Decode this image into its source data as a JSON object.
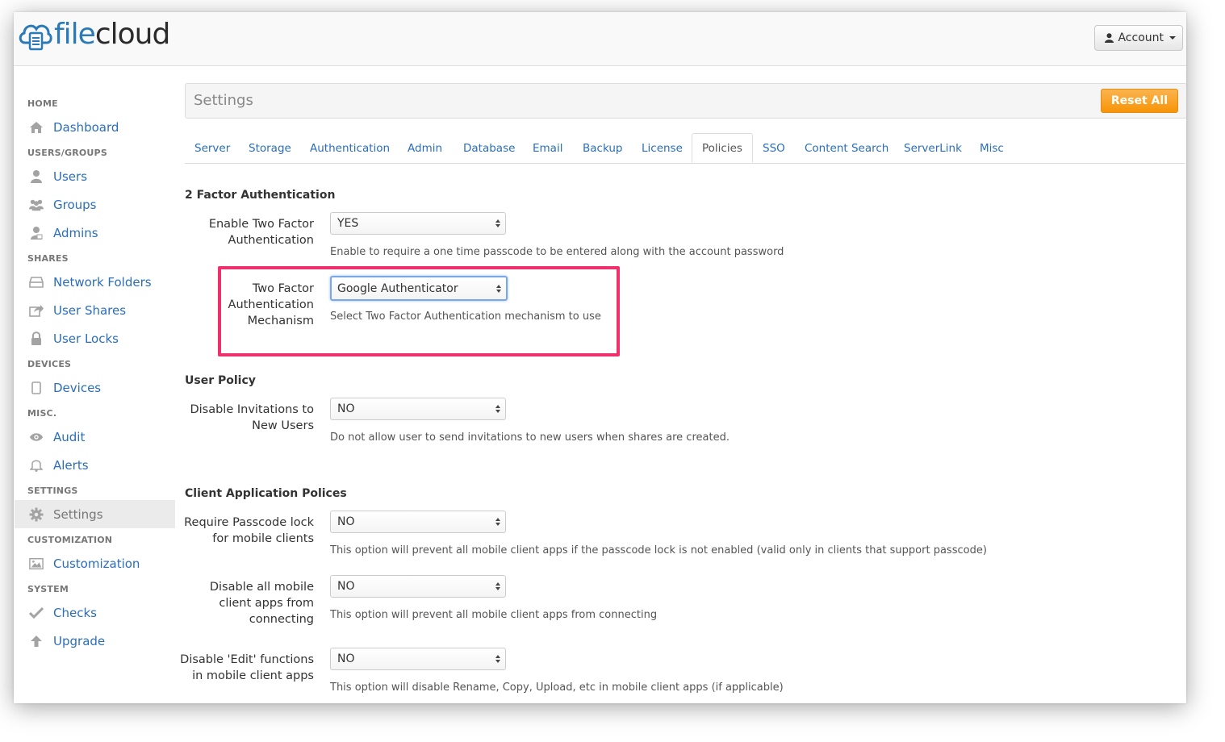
{
  "app": {
    "logo_file": "file",
    "logo_cloud": "cloud",
    "account_label": "Account"
  },
  "sidebar": {
    "sections": [
      {
        "label": "HOME"
      },
      {
        "label": "USERS/GROUPS"
      },
      {
        "label": "SHARES"
      },
      {
        "label": "DEVICES"
      },
      {
        "label": "MISC."
      },
      {
        "label": "SETTINGS"
      },
      {
        "label": "CUSTOMIZATION"
      },
      {
        "label": "SYSTEM"
      }
    ],
    "items": [
      {
        "label": "Dashboard",
        "icon": "home-icon"
      },
      {
        "label": "Users",
        "icon": "user-icon"
      },
      {
        "label": "Groups",
        "icon": "group-icon"
      },
      {
        "label": "Admins",
        "icon": "admin-icon"
      },
      {
        "label": "Network Folders",
        "icon": "drive-icon"
      },
      {
        "label": "User Shares",
        "icon": "share-icon"
      },
      {
        "label": "User Locks",
        "icon": "lock-icon"
      },
      {
        "label": "Devices",
        "icon": "device-icon"
      },
      {
        "label": "Audit",
        "icon": "eye-icon"
      },
      {
        "label": "Alerts",
        "icon": "bell-icon"
      },
      {
        "label": "Settings",
        "icon": "gear-icon",
        "active": true
      },
      {
        "label": "Customization",
        "icon": "picture-icon"
      },
      {
        "label": "Checks",
        "icon": "check-icon"
      },
      {
        "label": "Upgrade",
        "icon": "arrow-up-icon"
      }
    ]
  },
  "settings": {
    "title": "Settings",
    "reset_label": "Reset All"
  },
  "tabs": [
    {
      "label": "Server"
    },
    {
      "label": "Storage"
    },
    {
      "label": "Authentication"
    },
    {
      "label": "Admin"
    },
    {
      "label": "Database"
    },
    {
      "label": "Email"
    },
    {
      "label": "Backup"
    },
    {
      "label": "License"
    },
    {
      "label": "Policies",
      "active": true
    },
    {
      "label": "SSO"
    },
    {
      "label": "Content Search"
    },
    {
      "label": "ServerLink"
    },
    {
      "label": "Misc"
    }
  ],
  "sections": {
    "two_factor": "2 Factor Authentication",
    "user_policy": "User Policy",
    "client_app": "Client Application Polices"
  },
  "fields": [
    {
      "label_lines": [
        "Enable Two Factor",
        "Authentication"
      ],
      "value": "YES",
      "help": "Enable to require a one time passcode to be entered along with the account password"
    },
    {
      "label_lines": [
        "Two Factor",
        "Authentication",
        "Mechanism"
      ],
      "value": "Google Authenticator",
      "help": "Select Two Factor Authentication mechanism to use"
    },
    {
      "label_lines": [
        "Disable Invitations to",
        "New Users"
      ],
      "value": "NO",
      "help": "Do not allow user to send invitations to new users when shares are created."
    },
    {
      "label_lines": [
        "Require Passcode lock",
        "for mobile clients"
      ],
      "value": "NO",
      "help": "This option will prevent all mobile client apps if the passcode lock is not enabled (valid only in clients that support passcode)"
    },
    {
      "label_lines": [
        "Disable all mobile",
        "client apps from",
        "connecting"
      ],
      "value": "NO",
      "help": "This option will prevent all mobile client apps from connecting"
    },
    {
      "label_lines": [
        "Disable 'Edit' functions",
        "in mobile client apps"
      ],
      "value": "NO",
      "help": "This option will disable Rename, Copy, Upload, etc in mobile client apps (if applicable)"
    }
  ],
  "colors": {
    "link": "#2a6ebb",
    "accent_orange": "#f89406",
    "highlight": "#f0306c"
  }
}
